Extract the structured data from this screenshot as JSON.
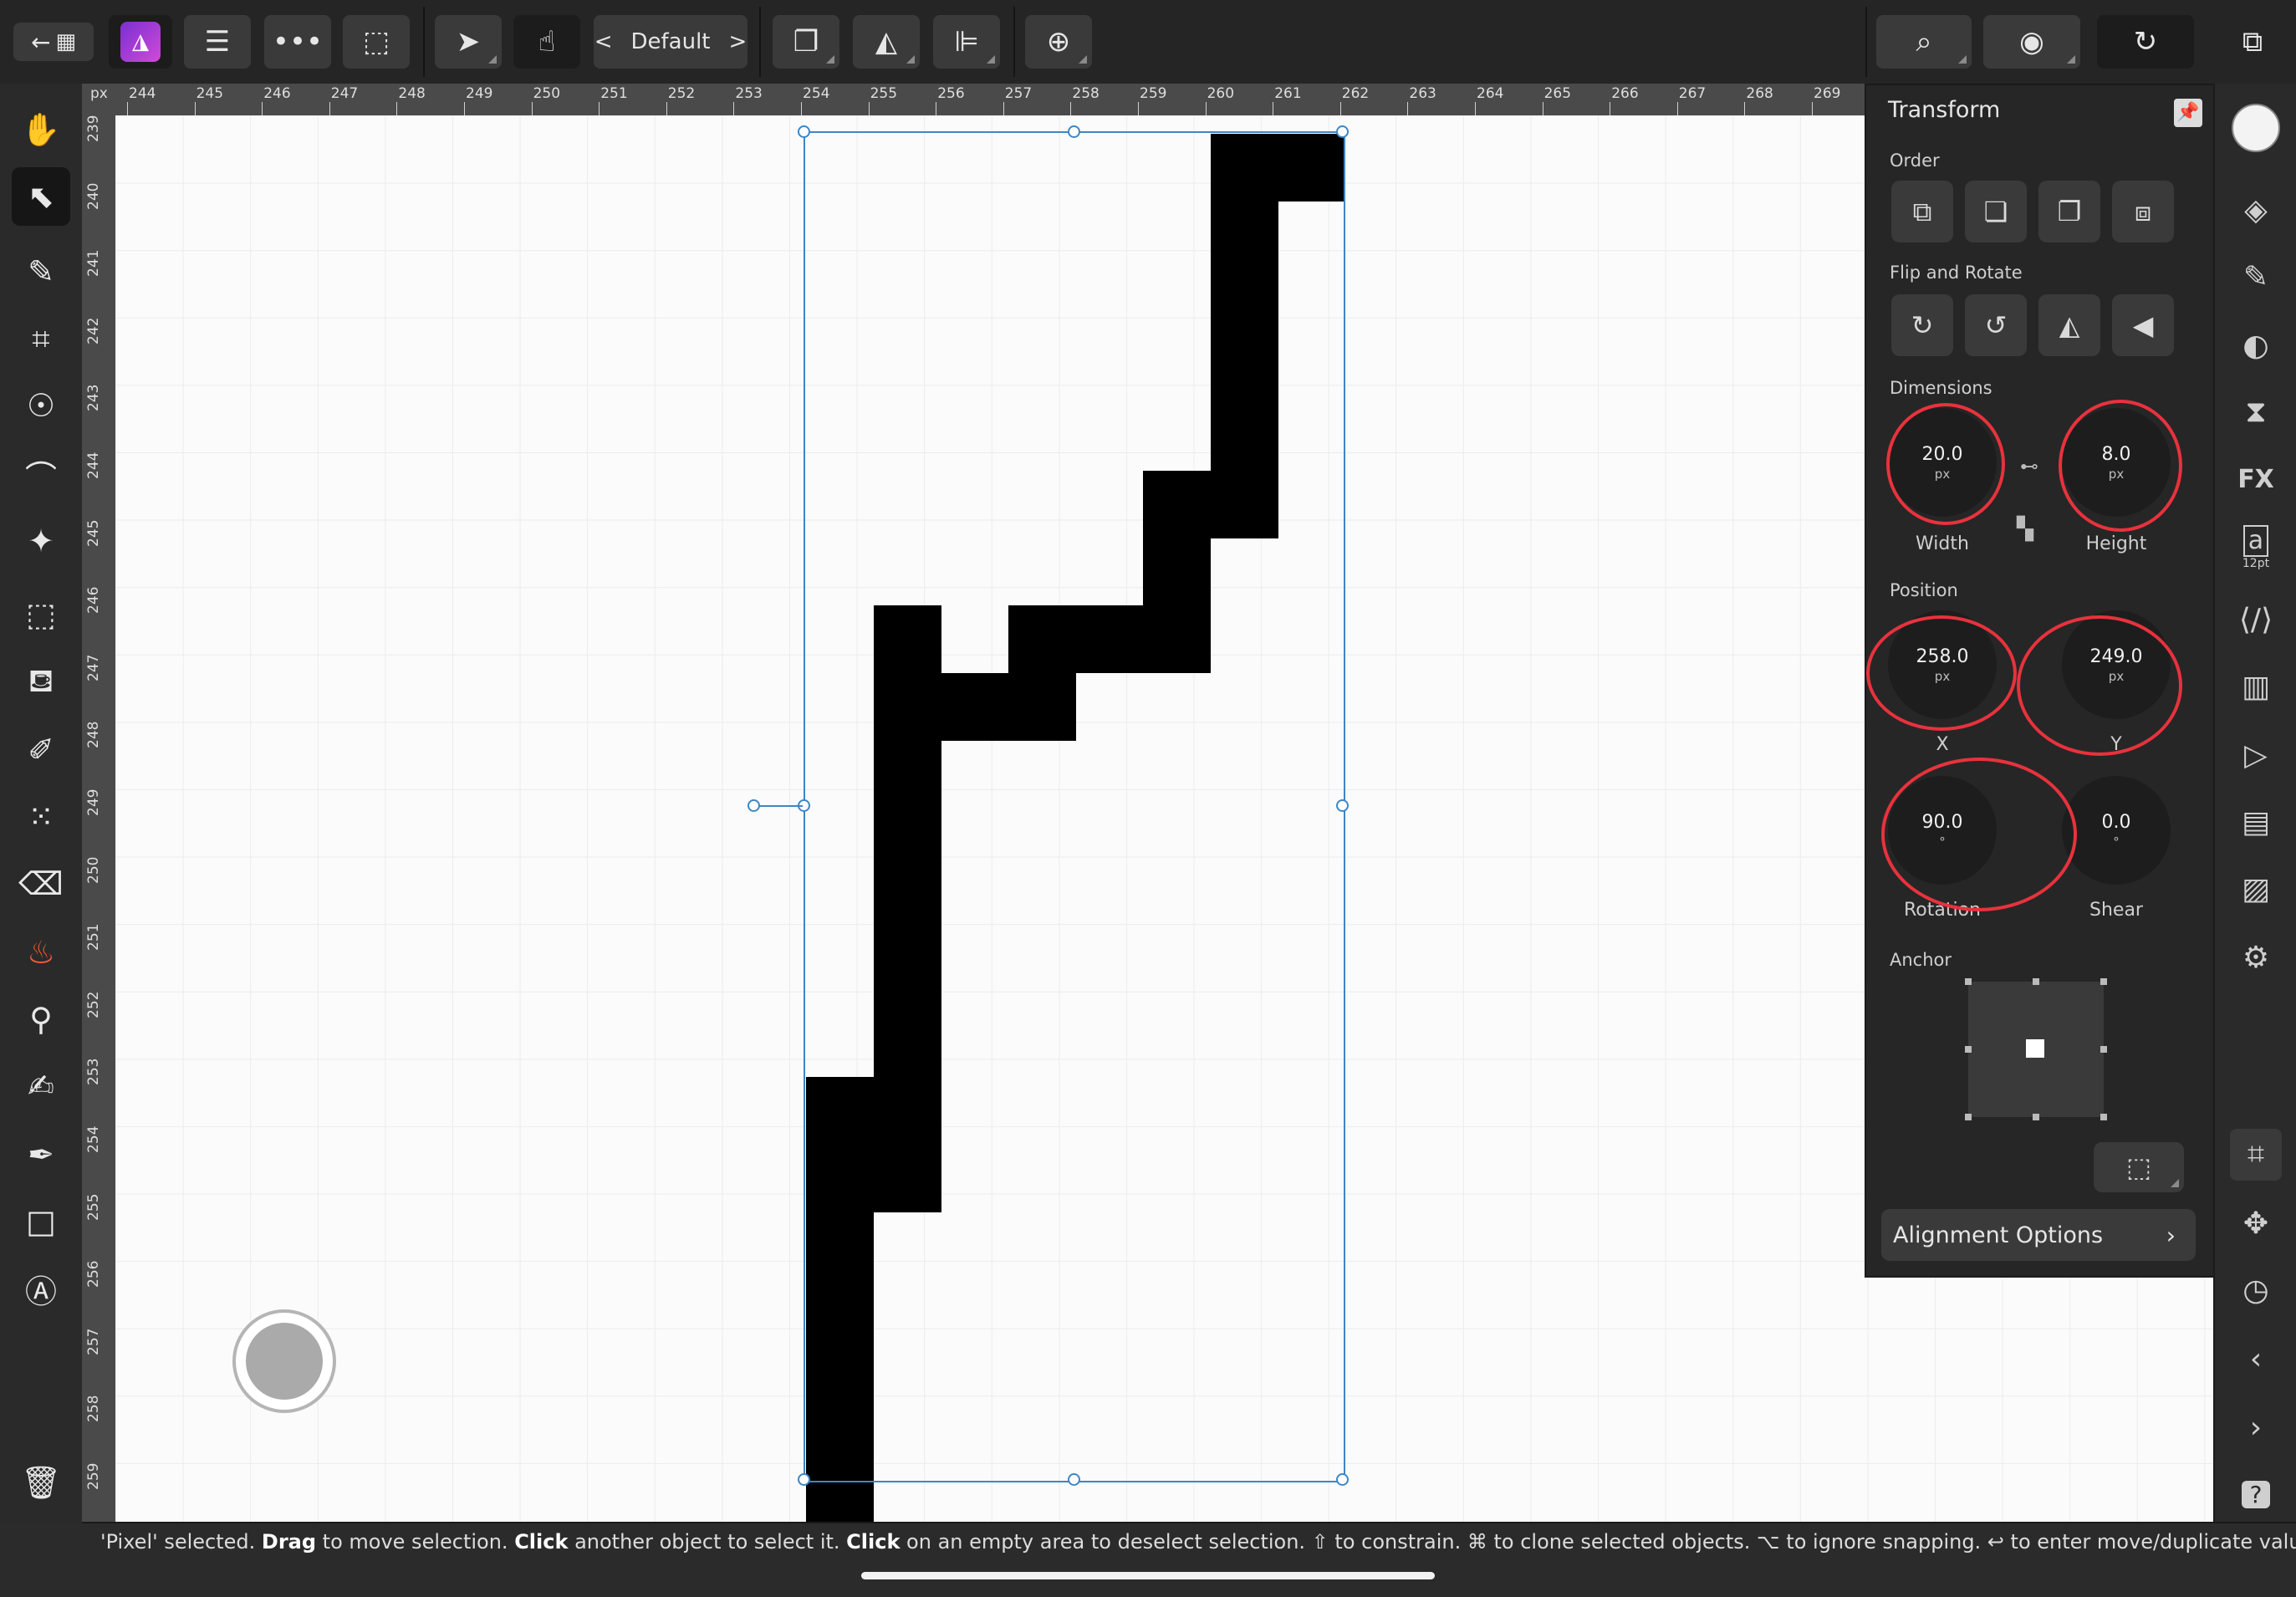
{
  "topbar": {
    "studio_label": "Default",
    "prev": "<",
    "next": ">"
  },
  "ruler": {
    "unit": "px",
    "x_ticks": [
      "244",
      "245",
      "246",
      "247",
      "248",
      "249",
      "250",
      "251",
      "252",
      "253",
      "254",
      "255",
      "256",
      "257",
      "258",
      "259",
      "260",
      "261",
      "262",
      "263",
      "264",
      "265",
      "266",
      "267",
      "268",
      "269"
    ],
    "y_ticks": [
      "239",
      "240",
      "241",
      "242",
      "243",
      "244",
      "245",
      "246",
      "247",
      "248",
      "249",
      "250",
      "251",
      "252",
      "253",
      "254",
      "255",
      "256",
      "257",
      "258",
      "259"
    ]
  },
  "panel": {
    "title": "Transform",
    "order_label": "Order",
    "flip_rotate_label": "Flip and Rotate",
    "dimensions_label": "Dimensions",
    "width_value": "20.0",
    "width_unit": "px",
    "width_label": "Width",
    "height_value": "8.0",
    "height_unit": "px",
    "height_label": "Height",
    "position_label": "Position",
    "x_value": "258.0",
    "x_unit": "px",
    "x_label": "X",
    "y_value": "249.0",
    "y_unit": "px",
    "y_label": "Y",
    "rotation_value": "90.0",
    "rotation_unit": "°",
    "rotation_label": "Rotation",
    "shear_value": "0.0",
    "shear_unit": "°",
    "shear_label": "Shear",
    "anchor_label": "Anchor",
    "alignment_options": "Alignment Options",
    "text_style_size": "12pt"
  },
  "status": {
    "p1": "'Pixel' selected. ",
    "b1": "Drag",
    "p2": " to move selection. ",
    "b2": "Click",
    "p3": " another object to select it. ",
    "b3": "Click",
    "p4": " on an empty area to deselect selection. ⇧ to constrain. ⌘ to clone selected objects. ⌥ to ignore snapping. ↩ to enter move/duplicate values."
  },
  "colors": {
    "accent_blue": "#3d86c6",
    "annotation_red": "#e8323d",
    "app_purple": "#9b3fd6"
  }
}
